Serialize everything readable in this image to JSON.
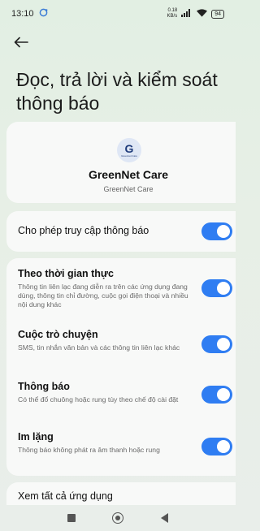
{
  "status_bar": {
    "time": "13:10",
    "network_speed_top": "0.18",
    "network_speed_bottom": "KB/s",
    "battery": "94"
  },
  "icons": {
    "back": "arrow-left-icon",
    "sync": "sync-icon",
    "signal": "signal-icon",
    "wifi": "wifi-icon"
  },
  "page": {
    "title": "Đọc, trả lời và kiểm soát thông báo"
  },
  "app": {
    "icon_letter": "G",
    "icon_caption": "Greennet Care",
    "name": "GreenNet Care",
    "subtitle": "GreenNet Care"
  },
  "allow_access": {
    "label": "Cho phép truy cập thông báo",
    "enabled": true
  },
  "notification_types": [
    {
      "title": "Theo thời gian thực",
      "description": "Thông tin liên lạc đang diễn ra trên các ứng dụng đang dùng, thông tin chỉ đường, cuộc gọi điện thoại và nhiều nội dung khác",
      "enabled": true
    },
    {
      "title": "Cuộc trò chuyện",
      "description": "SMS, tin nhắn văn bản và các thông tin liên lạc khác",
      "enabled": true
    },
    {
      "title": "Thông báo",
      "description": "Có thể đổ chuông hoặc rung tùy theo chế độ cài đặt",
      "enabled": true
    },
    {
      "title": "Im lặng",
      "description": "Thông báo không phát ra âm thanh hoặc rung",
      "enabled": true
    }
  ],
  "see_all": {
    "label": "Xem tất cả ứng dụng"
  },
  "colors": {
    "toggle_on": "#2f7df2",
    "background": "#e4efe4",
    "card": "#f8f9f8"
  }
}
